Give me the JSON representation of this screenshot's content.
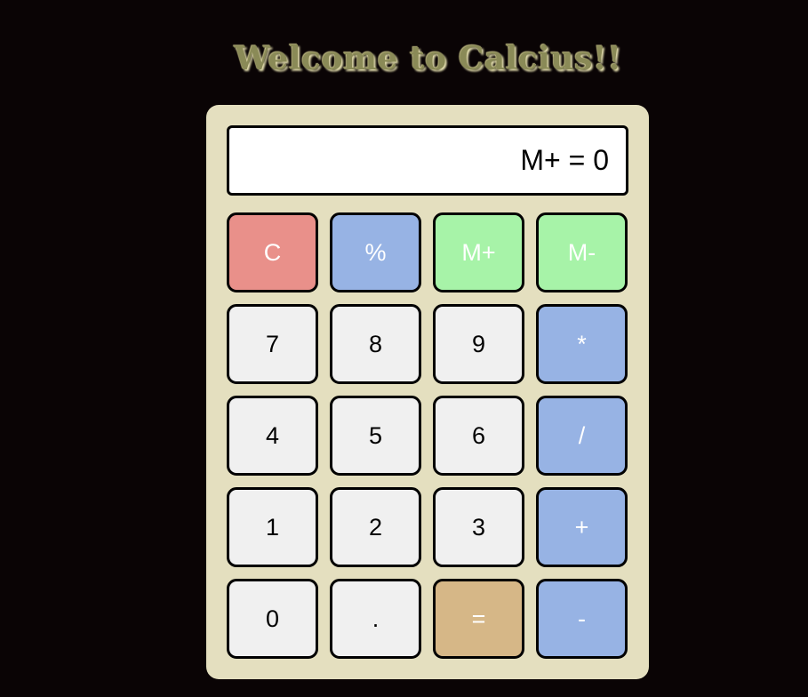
{
  "title": "Welcome to Calcius!!",
  "display": {
    "value": "M+ = 0"
  },
  "colors": {
    "background": "#0a0405",
    "calculator_body": "#e4dfbf",
    "number_key": "#f0f0f0",
    "operator_key": "#97b3e4",
    "clear_key": "#e9908a",
    "memory_key": "#a7f3a8",
    "equals_key": "#d6b787"
  },
  "keys": {
    "clear": "C",
    "percent": "%",
    "memory_plus": "M+",
    "memory_minus": "M-",
    "seven": "7",
    "eight": "8",
    "nine": "9",
    "multiply": "*",
    "four": "4",
    "five": "5",
    "six": "6",
    "divide": "/",
    "one": "1",
    "two": "2",
    "three": "3",
    "add": "+",
    "zero": "0",
    "decimal": ".",
    "equals": "=",
    "subtract": "-"
  }
}
